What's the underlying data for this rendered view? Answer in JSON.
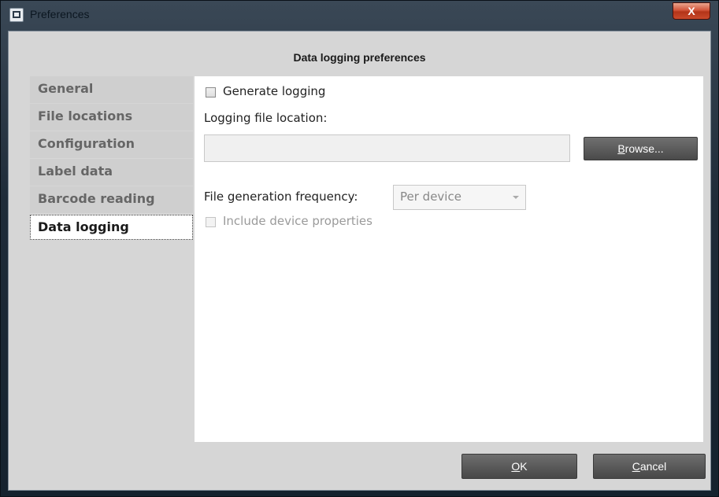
{
  "window": {
    "title": "Preferences",
    "close_label": "X"
  },
  "header": {
    "title": "Data logging preferences"
  },
  "sidebar": {
    "items": [
      {
        "label": "General"
      },
      {
        "label": "File locations"
      },
      {
        "label": "Configuration"
      },
      {
        "label": "Label data"
      },
      {
        "label": "Barcode reading"
      },
      {
        "label": "Data logging",
        "active": true
      }
    ]
  },
  "panel": {
    "generate_logging_label": "Generate logging",
    "generate_logging_checked": false,
    "file_location_label": "Logging file location:",
    "file_location_value": "",
    "browse_mnemonic": "B",
    "browse_rest": "rowse...",
    "frequency_label": "File generation frequency:",
    "frequency_value": "Per device",
    "include_props_label": "Include device properties",
    "include_props_checked": false
  },
  "footer": {
    "ok_mnemonic": "O",
    "ok_rest": "K",
    "cancel_mnemonic": "C",
    "cancel_rest": "ancel"
  }
}
